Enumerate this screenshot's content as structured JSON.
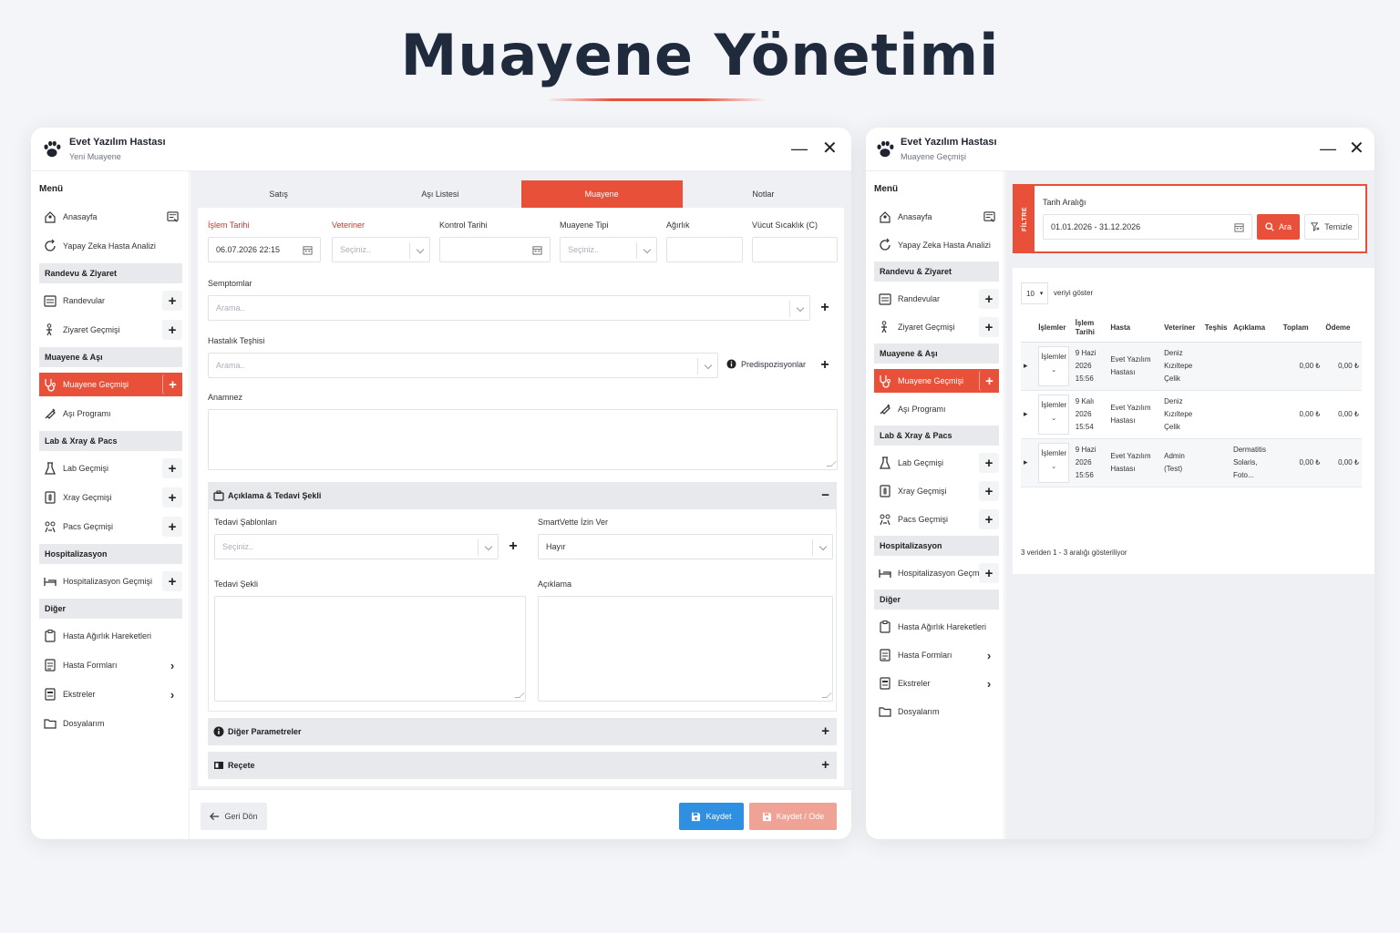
{
  "hero_title": "Muayene Yönetimi",
  "colors": {
    "accent": "#e8503a",
    "save": "#2f8fe0",
    "save_pay": "#f0a294"
  },
  "window1": {
    "app_title": "Evet Yazılım Hastası",
    "subtitle": "Yeni Muayene",
    "minimize": "—",
    "close": "✕",
    "menu_title": "Menü",
    "sidebar": [
      {
        "label": "Anasayfa",
        "icon": "home-user-icon",
        "action": "board"
      },
      {
        "label": "Yapay Zeka Hasta Analizi",
        "icon": "ai-refresh-icon"
      },
      {
        "section": "Randevu & Ziyaret"
      },
      {
        "label": "Randevular",
        "icon": "calendar-list-icon",
        "action": "plus"
      },
      {
        "label": "Ziyaret Geçmişi",
        "icon": "visit-icon",
        "action": "plus"
      },
      {
        "section": "Muayene & Aşı"
      },
      {
        "label": "Muayene Geçmişi",
        "icon": "stethoscope-icon",
        "action": "plus",
        "active": true
      },
      {
        "label": "Aşı Programı",
        "icon": "syringe-icon"
      },
      {
        "section": "Lab & Xray & Pacs"
      },
      {
        "label": "Lab Geçmişi",
        "icon": "flask-icon",
        "action": "plus"
      },
      {
        "label": "Xray Geçmişi",
        "icon": "xray-icon",
        "action": "plus"
      },
      {
        "label": "Pacs Geçmişi",
        "icon": "pacs-icon",
        "action": "plus"
      },
      {
        "section": "Hospitalizasyon"
      },
      {
        "label": "Hospitalizasyon Geçmişi",
        "icon": "bed-icon",
        "action": "plus"
      },
      {
        "section": "Diğer"
      },
      {
        "label": "Hasta Ağırlık Hareketleri",
        "icon": "clipboard-icon"
      },
      {
        "label": "Hasta Formları",
        "icon": "form-icon",
        "action": "arrow"
      },
      {
        "label": "Ekstreler",
        "icon": "statement-icon",
        "action": "arrow"
      },
      {
        "label": "Dosyalarım",
        "icon": "folder-icon"
      }
    ],
    "tabs": [
      {
        "label": "Satış"
      },
      {
        "label": "Aşı Listesi"
      },
      {
        "label": "Muayene",
        "active": true
      },
      {
        "label": "Notlar"
      }
    ],
    "form": {
      "islem_tarihi_label": "İşlem Tarihi",
      "islem_tarihi_value": "06.07.2026 22:15",
      "veteriner_label": "Veteriner",
      "veteriner_placeholder": "Seçiniz..",
      "kontrol_tarihi_label": "Kontrol Tarihi",
      "muayene_tipi_label": "Muayene Tipi",
      "muayene_tipi_placeholder": "Seçiniz..",
      "agirlik_label": "Ağırlık",
      "vucut_sicaklik_label": "Vücut Sıcaklık (C)",
      "semptomlar_label": "Semptomlar",
      "semptomlar_placeholder": "Arama..",
      "hastalik_teshisi_label": "Hastalık Teşhisi",
      "hastalik_teshisi_placeholder": "Arama..",
      "predispozisyonlar": "Predispozisyonlar",
      "anamnez_label": "Anamnez"
    },
    "aciklama_section": {
      "title": "Açıklama & Tedavi Şekli",
      "toggle": "−",
      "tedavi_sablonlari_label": "Tedavi Şablonları",
      "tedavi_sablonlari_placeholder": "Seçiniz..",
      "smartvette_label": "SmartVette İzin Ver",
      "smartvette_value": "Hayır",
      "tedavi_sekli_label": "Tedavi Şekli",
      "aciklama_label": "Açıklama"
    },
    "diger_parametreler": {
      "title": "Diğer Parametreler",
      "toggle": "+"
    },
    "recete": {
      "title": "Reçete",
      "toggle": "+"
    },
    "footer": {
      "back": "Geri Dön",
      "save": "Kaydet",
      "save_pay": "Kaydet / Ode"
    }
  },
  "window2": {
    "app_title": "Evet Yazılım Hastası",
    "subtitle": "Muayene Geçmişi",
    "minimize": "—",
    "close": "✕",
    "menu_title": "Menü",
    "filter": {
      "tag": "FİLTRE",
      "label": "Tarih Aralığı",
      "range": "01.01.2026 - 31.12.2026",
      "search": "Ara",
      "clear": "Temizle"
    },
    "table": {
      "page_size": "10",
      "page_size_suffix": "veriyi göster",
      "columns": [
        "İşlemler",
        "İşlem Tarihi",
        "Hasta",
        "Veteriner",
        "Teşhis",
        "Açıklama",
        "Toplam",
        "Ödeme"
      ],
      "action_label": "İşlemler",
      "rows": [
        {
          "date": "9 Hazi 2026 15:56",
          "hasta": "Evet Yazılım Hastası",
          "veteriner": "Deniz Kızıltepe Çelik",
          "teshis": "",
          "aciklama": "",
          "toplam": "0,00 ₺",
          "odeme": "0,00 ₺"
        },
        {
          "date": "9 Kalı 2026 15:54",
          "hasta": "Evet Yazılım Hastası",
          "veteriner": "Deniz Kızıltepe Çelik",
          "teshis": "",
          "aciklama": "",
          "toplam": "0,00 ₺",
          "odeme": "0,00 ₺"
        },
        {
          "date": "9 Hazi 2026 15:56",
          "hasta": "Evet Yazılım Hastası",
          "veteriner": "Admin (Test)",
          "teshis": "",
          "aciklama": "Dermatitis Solaris, Foto...",
          "toplam": "0,00 ₺",
          "odeme": "0,00 ₺"
        }
      ],
      "summary": "3 veriden 1 - 3 aralığı gösteriliyor"
    }
  }
}
